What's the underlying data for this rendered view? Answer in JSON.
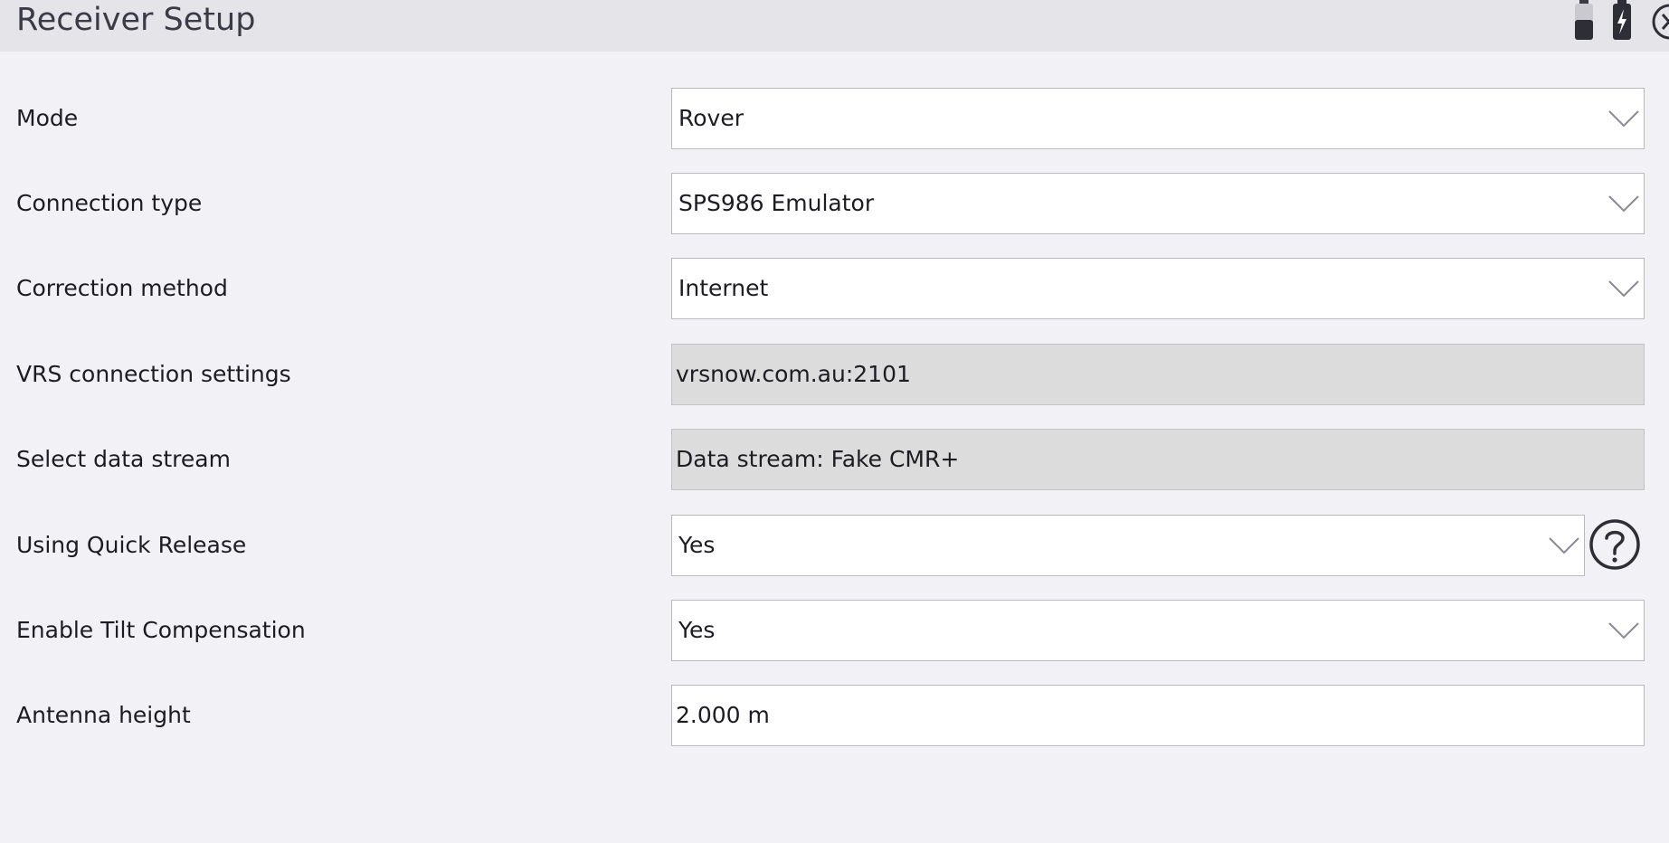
{
  "window": {
    "title": "Receiver Setup"
  },
  "status_icons": [
    "battery-icon",
    "charging-battery-icon",
    "close-icon"
  ],
  "form": {
    "mode": {
      "label": "Mode",
      "value": "Rover"
    },
    "connection_type": {
      "label": "Connection type",
      "value": "SPS986 Emulator"
    },
    "correction_method": {
      "label": "Correction method",
      "value": "Internet"
    },
    "vrs_settings": {
      "label": "VRS connection settings",
      "value": "vrsnow.com.au:2101"
    },
    "data_stream": {
      "label": "Select data stream",
      "value": "Data stream: Fake CMR+"
    },
    "quick_release": {
      "label": "Using Quick Release",
      "value": "Yes"
    },
    "tilt_compensation": {
      "label": "Enable Tilt Compensation",
      "value": "Yes"
    },
    "antenna_height": {
      "label": "Antenna height",
      "value": "2.000 m"
    }
  },
  "colors": {
    "background": "#f2f2f6",
    "titlebar": "#e4e4e9",
    "readonly_field": "#dcdcdc"
  }
}
